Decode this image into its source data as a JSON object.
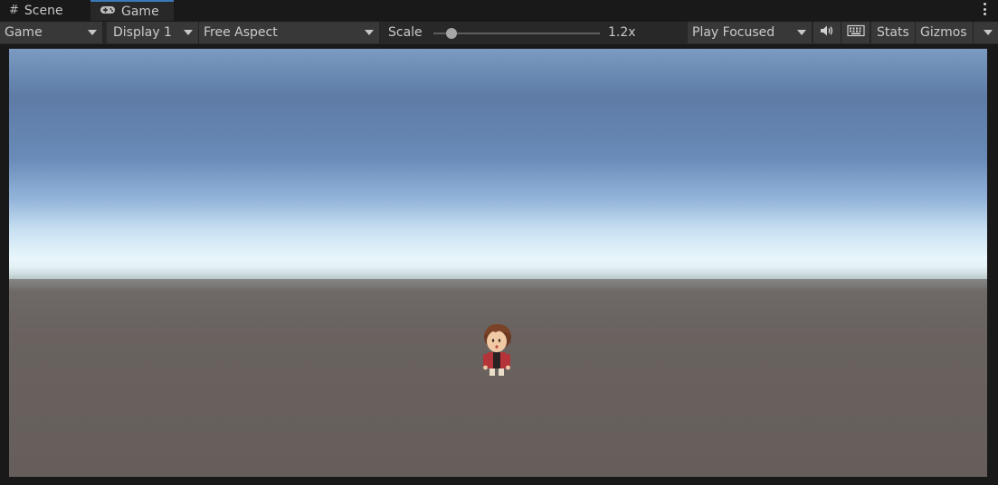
{
  "tabs": {
    "scene": {
      "label": "Scene",
      "icon": "grid-icon"
    },
    "game": {
      "label": "Game",
      "icon": "gamepad-icon"
    }
  },
  "toolbar": {
    "display_mode": "Game",
    "display": "Display 1",
    "aspect": "Free Aspect",
    "scale_label": "Scale",
    "scale_value": "1.2x",
    "scale_fraction": 0.11,
    "play_mode": "Play Focused",
    "stats_label": "Stats",
    "gizmos_label": "Gizmos"
  },
  "colors": {
    "active_tab_accent": "#3a79bb",
    "toolbar_bg": "#383838",
    "panel_bg": "#282828",
    "ground": "#6a6360",
    "sky_top": "#5d7ba5"
  }
}
